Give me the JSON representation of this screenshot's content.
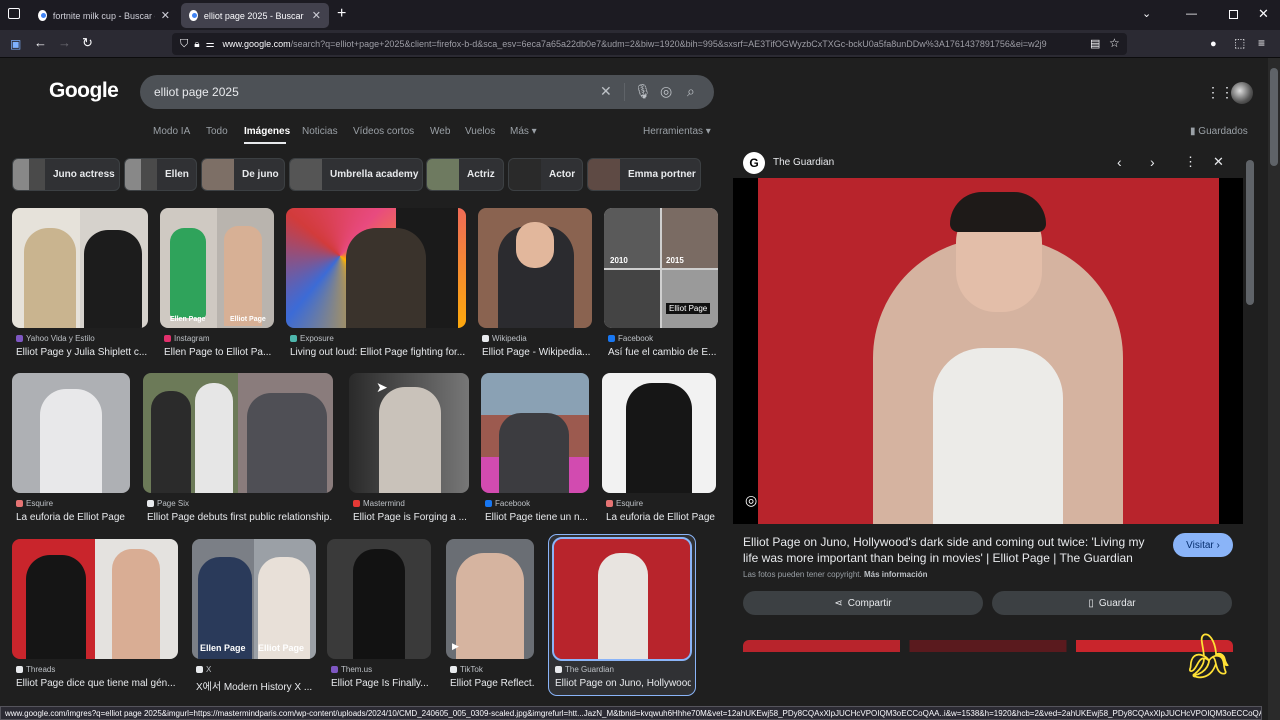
{
  "browser": {
    "tabs": [
      {
        "title": "fortnite milk cup - Buscar con G",
        "active": false
      },
      {
        "title": "elliot page 2025 - Buscar con G",
        "active": true
      }
    ],
    "new_tab": "+",
    "url_domain": "www.google.com",
    "url_rest": "/search?q=elliot+page+2025&client=firefox-b-d&sca_esv=6eca7a65a22db0e7&udm=2&biw=1920&bih=995&sxsrf=AE3TifOGWyzbCxTXGc-bckU0a5fa8unDDw%3A1761437891756&ei=w2j9",
    "status_url": "www.google.com/imgres?q=elliot page 2025&imgurl=https://mastermindparis.com/wp-content/uploads/2024/10/CMD_240605_005_0309-scaled.jpg&imgrefurl=htt...JazN_M&tbnid=kvqwuh6Hhhe70M&vet=12ahUKEwj58_PDy8CQAxXlpJUCHcVPOIQM3oECCoQAA..i&w=1538&h=1920&hcb=2&ved=2ahUKEwj58_PDy8CQAxXlpJUCHcVPOIQM3oECCoQAA"
  },
  "google": {
    "logo": "Google",
    "query": "elliot page 2025",
    "nav_tabs": [
      "Modo IA",
      "Todo",
      "Imágenes",
      "Noticias",
      "Vídeos cortos",
      "Web",
      "Vuelos",
      "Más ▾"
    ],
    "tools": "Herramientas ▾",
    "saved": "Guardados",
    "chips": [
      "Juno actress",
      "Ellen",
      "De juno",
      "Umbrella academy",
      "Actriz",
      "Actor",
      "Emma portner"
    ],
    "results": [
      {
        "source": "Yahoo Vida y Estilo",
        "caption": "Elliot Page y Julia Shiplett c..."
      },
      {
        "source": "Instagram",
        "caption": "Ellen Page to Elliot Pa..."
      },
      {
        "source": "Exposure",
        "caption": "Living out loud: Elliot Page fighting for..."
      },
      {
        "source": "Wikipedia",
        "caption": "Elliot Page - Wikipedia..."
      },
      {
        "source": "Facebook",
        "caption": "Así fue el cambio de E..."
      },
      {
        "source": "Esquire",
        "caption": "La euforia de Elliot Page"
      },
      {
        "source": "Page Six",
        "caption": "Elliot Page debuts first public relationship..."
      },
      {
        "source": "Mastermind",
        "caption": "Elliot Page is Forging a ..."
      },
      {
        "source": "Facebook",
        "caption": "Elliot Page tiene un n..."
      },
      {
        "source": "Esquire",
        "caption": "La euforia de Elliot Page"
      },
      {
        "source": "Threads",
        "caption": "Elliot Page dice que tiene mal gén..."
      },
      {
        "source": "X",
        "caption": "X에서 Modern History X ..."
      },
      {
        "source": "Them.us",
        "caption": "Elliot Page Is Finally..."
      },
      {
        "source": "TikTok",
        "caption": "Elliot Page Reflect..."
      },
      {
        "source": "The Guardian",
        "caption": "Elliot Page on Juno, Hollywood's d..."
      }
    ],
    "overlays": {
      "year1": "2010",
      "year2": "2015",
      "name_tag": "Elliot Page",
      "tag_ellen": "Ellen Page",
      "tag_elliot": "Elliot Page"
    }
  },
  "panel": {
    "source": "The Guardian",
    "title": "Elliot Page on Juno, Hollywood's dark side and coming out twice: 'Living my life was more important than being in movies' | Elliot Page | The Guardian",
    "visit": "Visitar ›",
    "copyright": "Las fotos pueden tener copyright.",
    "more_info": "Más información",
    "share": "Compartir",
    "save": "Guardar"
  },
  "colors": {
    "accent": "#8ab4f8",
    "page_bg": "#1f1f1f",
    "photo_red": "#b8242c"
  }
}
